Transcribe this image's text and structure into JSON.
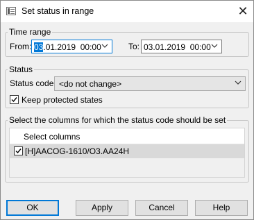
{
  "window": {
    "title": "Set status in range",
    "close_symbol": "✕"
  },
  "time_range": {
    "legend": "Time range",
    "from_label": "From:",
    "from_value_selected": "03",
    "from_value_rest": ".01.2019  00:00",
    "to_label": "To:",
    "to_value": "03.01.2019  00:00"
  },
  "status": {
    "legend": "Status",
    "code_label": "Status code:",
    "code_value": "<do not change>",
    "keep_protected_label": "Keep protected states",
    "keep_protected_checked": true
  },
  "columns": {
    "legend": "Select the columns for which the status code should be set",
    "header": "Select columns",
    "rows": [
      {
        "label": "[H]AACOG-1610/O3.AA24H",
        "checked": true
      }
    ]
  },
  "buttons": {
    "ok": "OK",
    "apply": "Apply",
    "cancel": "Cancel",
    "help": "Help"
  },
  "colors": {
    "accent": "#0078d7",
    "background": "#f0f0f0"
  }
}
